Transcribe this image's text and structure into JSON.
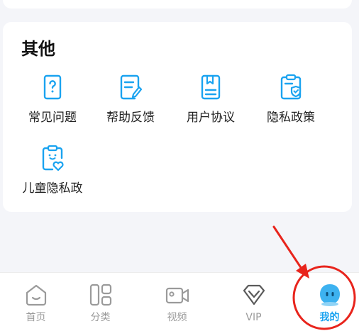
{
  "section": {
    "title": "其他",
    "items": [
      {
        "label": "常见问题",
        "icon": "question-document-icon"
      },
      {
        "label": "帮助反馈",
        "icon": "feedback-edit-icon"
      },
      {
        "label": "用户协议",
        "icon": "agreement-book-icon"
      },
      {
        "label": "隐私政策",
        "icon": "privacy-shield-icon"
      },
      {
        "label": "儿童隐私政",
        "icon": "child-privacy-icon"
      }
    ]
  },
  "tabbar": {
    "tabs": [
      {
        "label": "首页",
        "icon": "home-icon"
      },
      {
        "label": "分类",
        "icon": "category-icon"
      },
      {
        "label": "视频",
        "icon": "video-camera-icon"
      },
      {
        "label": "VIP",
        "icon": "vip-diamond-icon"
      },
      {
        "label": "我的",
        "icon": "profile-avatar-icon",
        "active": true
      }
    ]
  },
  "colors": {
    "accent": "#1aa3f0",
    "inactive": "#9a9a9a",
    "annotation": "#e8241c"
  }
}
